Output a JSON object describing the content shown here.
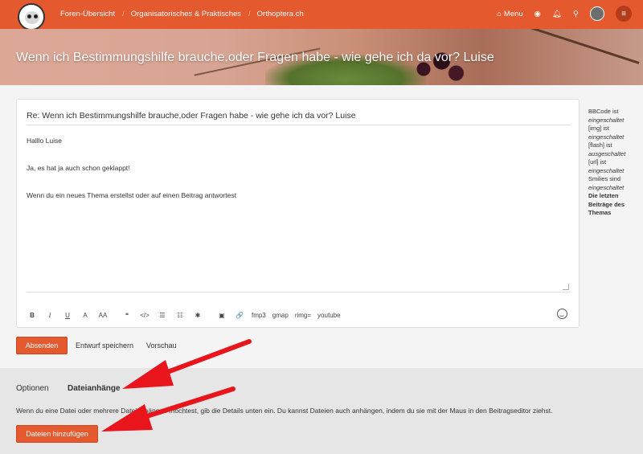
{
  "nav": {
    "breadcrumbs": [
      "Foren-Übersicht",
      "Organisatorisches & Praktisches",
      "Orthoptera.ch"
    ],
    "menu_label": "Menu",
    "icons": [
      "home-icon",
      "dashboard-icon",
      "bell-icon",
      "search-icon",
      "avatar",
      "hamburger-icon"
    ]
  },
  "banner": {
    "title": "Wenn ich Bestimmungshilfe brauche,oder Fragen habe - wie gehe ich da vor? Luise"
  },
  "editor": {
    "subject": "Re: Wenn ich Bestimmungshilfe brauche,oder Fragen habe -  wie gehe ich da vor? Luise",
    "body_lines": [
      "Halllo Luise",
      "Ja, es hat ja auch schon geklappt!",
      "Wenn du ein neues Thema erstellst oder auf einen Beitrag antwortest"
    ],
    "toolbar": {
      "bold": "B",
      "italic": "I",
      "underline": "U",
      "fontsize": "A",
      "fontsize2": "AA",
      "quote": "❝",
      "code": "</>",
      "list": "☰",
      "olist": "☷",
      "star": "✱",
      "image": "▣",
      "link": "🔗",
      "fmp3": "fmp3",
      "gmap": "gmap",
      "rimg": "rimg=",
      "youtube": "youtube"
    }
  },
  "sidebar": {
    "lines": [
      {
        "text": "BBCode ist ",
        "emph": "eingeschaltet"
      },
      {
        "text": "[img] ist ",
        "emph": "eingeschaltet"
      },
      {
        "text": "[flash] ist ",
        "emph": "ausgeschaltet"
      },
      {
        "text": "[url] ist ",
        "emph": "eingeschaltet"
      },
      {
        "text": "Smilies sind ",
        "emph": "eingeschaltet"
      }
    ],
    "recent_posts": "Die letzten Beiträge des Themas"
  },
  "actions": {
    "submit": "Absenden",
    "save_draft": "Entwurf speichern",
    "preview": "Vorschau"
  },
  "lower": {
    "tabs": [
      "Optionen",
      "Dateianhänge"
    ],
    "description": "Wenn du eine Datei oder mehrere Dateianhängen möchtest, gib die Details unten ein. Du kannst Dateien auch anhängen, indem du sie mit der Maus in den Beitragseditor ziehst.",
    "add_files": "Dateien hinzufügen"
  },
  "colors": {
    "accent": "#e5592e",
    "annotation_arrow": "#e8161c"
  }
}
